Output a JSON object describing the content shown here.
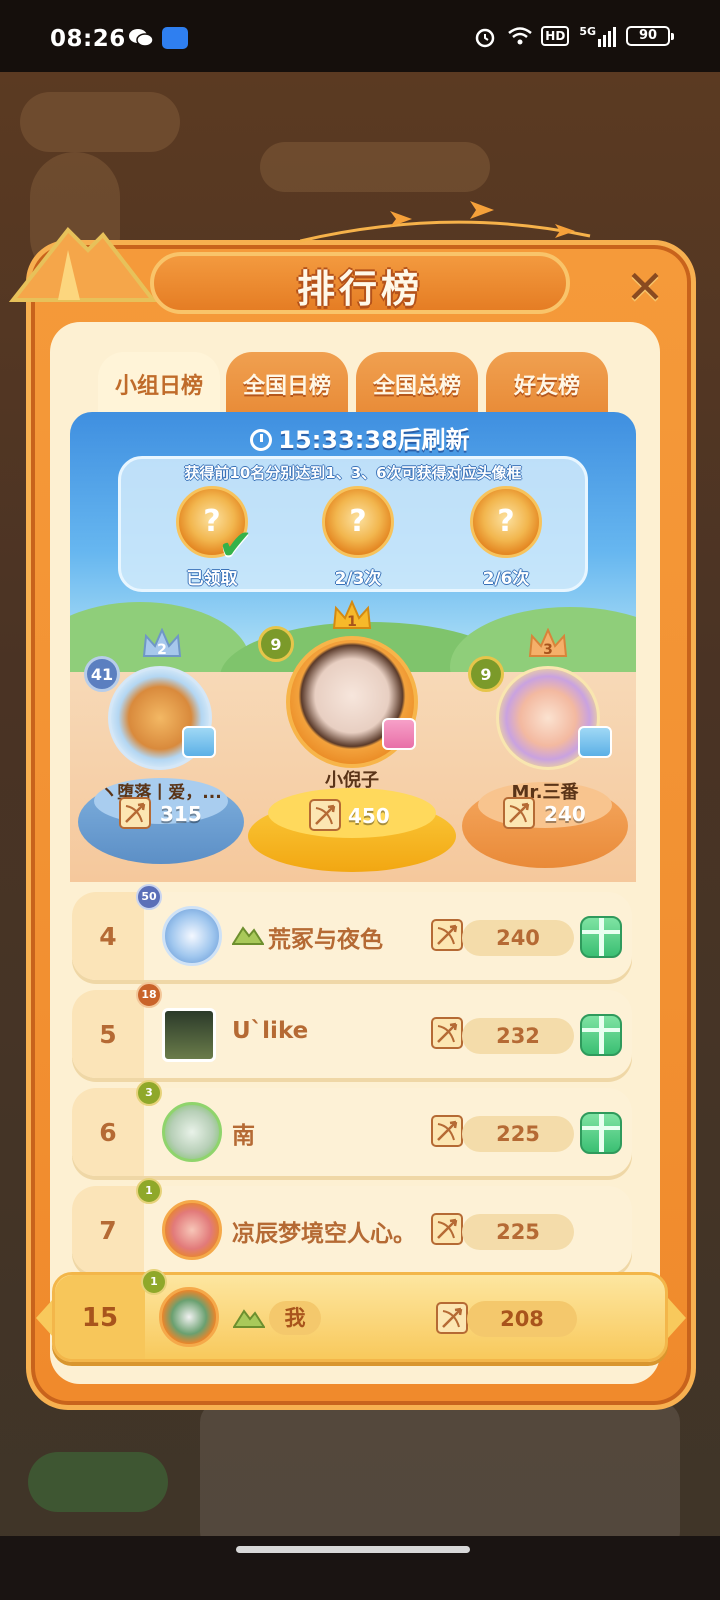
{
  "status_bar": {
    "time": "08:26",
    "network": "5G",
    "hd": "HD",
    "battery": "90"
  },
  "title": "排行榜",
  "tabs": [
    {
      "label": "小组日榜",
      "active": true
    },
    {
      "label": "全国日榜",
      "active": false
    },
    {
      "label": "全国总榜",
      "active": false
    },
    {
      "label": "好友榜",
      "active": false
    }
  ],
  "refresh": {
    "countdown": "15:33:38",
    "suffix": "后刷新"
  },
  "reward_hint": "获得前10名分别达到1、3、6次可获得对应头像框",
  "rewards": [
    {
      "status": "已领取",
      "claimed": true
    },
    {
      "status": "2/3次",
      "claimed": false
    },
    {
      "status": "2/6次",
      "claimed": false
    }
  ],
  "podium": {
    "first": {
      "rank": "1",
      "level": "9",
      "name": "小倪子",
      "score": "450"
    },
    "second": {
      "rank": "2",
      "level": "41",
      "name": "ヽ堕落丨爱，...",
      "score": "315"
    },
    "third": {
      "rank": "3",
      "level": "9",
      "name": "Mr.三番",
      "score": "240"
    }
  },
  "rows": [
    {
      "rank": "4",
      "level": "50",
      "name": "荒冢与夜色",
      "score": "240"
    },
    {
      "rank": "5",
      "level": "18",
      "name": "U`like",
      "score": "232"
    },
    {
      "rank": "6",
      "level": "3",
      "name": "南",
      "score": "225"
    },
    {
      "rank": "7",
      "level": "1",
      "name": "凉辰梦境空人心。",
      "score": "225"
    }
  ],
  "me": {
    "rank": "15",
    "level": "1",
    "name": "我",
    "score": "208"
  },
  "colors": {
    "accent_orange": "#f08a2c",
    "panel_cream": "#fdf0d2",
    "rank_brown": "#b56a34",
    "gift_green": "#3bbf73"
  }
}
